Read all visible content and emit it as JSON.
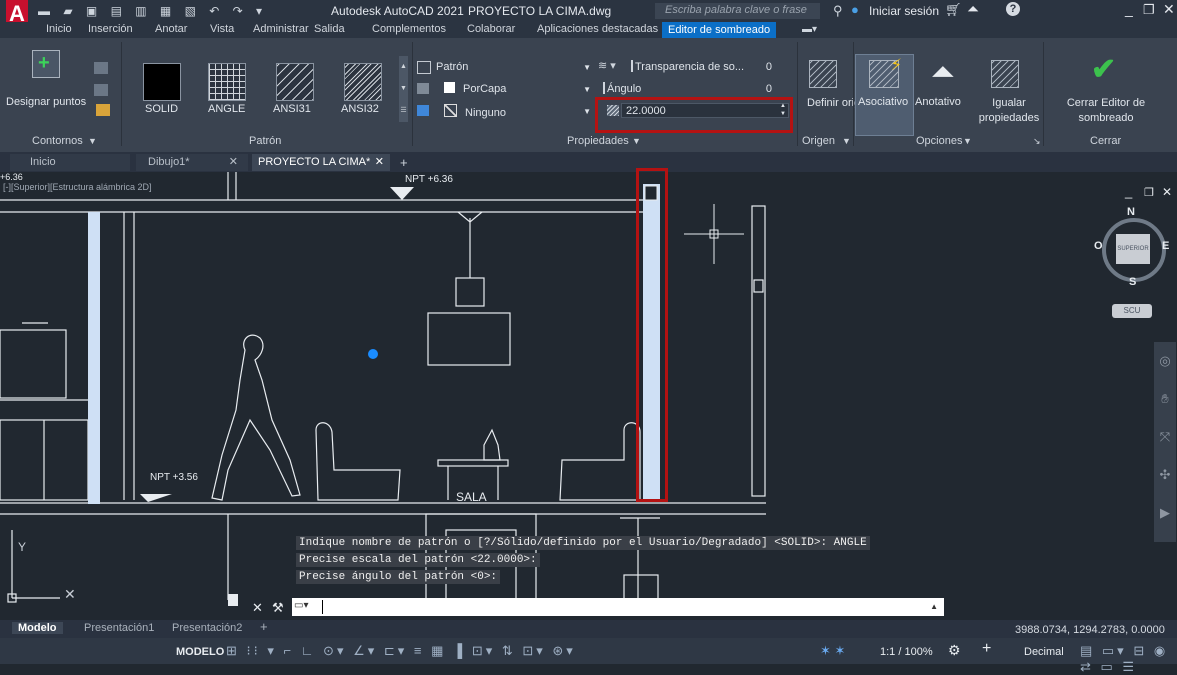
{
  "title_bar": {
    "app_title": "Autodesk AutoCAD 2021",
    "file_name": "PROYECTO LA CIMA.dwg",
    "search_placeholder": "Escriba palabra clave o frase",
    "sign_in": "Iniciar sesión"
  },
  "ribbon_tabs": [
    "Inicio",
    "Inserción",
    "Anotar",
    "Vista",
    "Administrar",
    "Salida",
    "Complementos",
    "Colaborar",
    "Aplicaciones destacadas",
    "Editor de sombreado"
  ],
  "ribbon": {
    "designar_puntos": "Designar puntos",
    "contornos": "Contornos",
    "patterns": [
      "SOLID",
      "ANGLE",
      "ANSI31",
      "ANSI32"
    ],
    "patron_panel": "Patrón",
    "type_value": "Patrón",
    "color_value": "PorCapa",
    "background_value": "Ninguno",
    "transparency_label": "Transparencia de so...",
    "transparency_value": "0",
    "angle_label": "Ángulo",
    "angle_value": "0",
    "scale_value": "22.0000",
    "propiedades_panel": "Propiedades",
    "definir_origen": "Definir origen",
    "origen_panel": "Origen",
    "asociativo": "Asociativo",
    "anotativo": "Anotativo",
    "igualar_propiedades": "Igualar propiedades",
    "opciones_panel": "Opciones",
    "cerrar_editor": "Cerrar Editor de sombreado",
    "cerrar_panel": "Cerrar"
  },
  "doc_tabs": [
    "Inicio",
    "Dibujo1*",
    "PROYECTO LA CIMA*"
  ],
  "viewport": {
    "label": "[-][Superior][Estructura alámbrica 2D]",
    "elev_top_left": "+6.36",
    "npt_top": "NPT +6.36",
    "npt_bottom": "NPT +3.56",
    "room_label": "SALA",
    "compass": {
      "n": "N",
      "s": "S",
      "e": "E",
      "w": "O",
      "center": "SUPERIOR"
    },
    "ucs": "SCU"
  },
  "command_history": [
    "Indique nombre de patrón o [?/Sólido/definido por el Usuario/Degradado] <SOLID>: ANGLE",
    "Precise escala del patrón <22.0000>:",
    "Precise ángulo del patrón <0>:"
  ],
  "layout_tabs": [
    "Modelo",
    "Presentación1",
    "Presentación2"
  ],
  "status": {
    "coordinates": "3988.0734, 1294.2783, 0.0000",
    "model": "MODELO",
    "scale": "1:1 / 100%",
    "units": "Decimal"
  },
  "colors": {
    "accent": "#0b6fc7",
    "highlight_box": "#b41212",
    "cad_bg": "#212830"
  }
}
